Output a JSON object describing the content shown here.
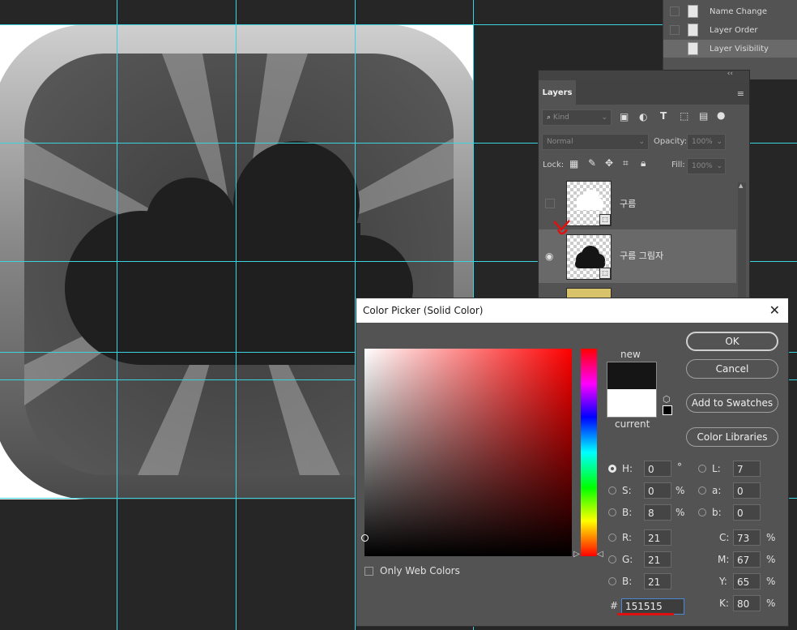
{
  "history": {
    "items": [
      "Name Change",
      "Layer Order",
      "Layer Visibility"
    ]
  },
  "layers_panel": {
    "tab": "Layers",
    "kind_placeholder": "Kind",
    "blend_mode": "Normal",
    "opacity_label": "Opacity:",
    "opacity_value": "100%",
    "lock_label": "Lock:",
    "fill_label": "Fill:",
    "fill_value": "100%",
    "layers": [
      {
        "name": "구름",
        "visible": false
      },
      {
        "name": "구름 그림자",
        "visible": true
      }
    ]
  },
  "color_picker": {
    "title": "Color Picker (Solid Color)",
    "new_label": "new",
    "current_label": "current",
    "new_color": "#151515",
    "current_color": "#ffffff",
    "buttons": {
      "ok": "OK",
      "cancel": "Cancel",
      "add_to_swatches": "Add to Swatches",
      "color_libraries": "Color Libraries"
    },
    "only_web_colors": "Only Web Colors",
    "fields": {
      "H": {
        "label": "H:",
        "value": "0",
        "unit": "°"
      },
      "S": {
        "label": "S:",
        "value": "0",
        "unit": "%"
      },
      "B": {
        "label": "B:",
        "value": "8",
        "unit": "%"
      },
      "R": {
        "label": "R:",
        "value": "21"
      },
      "G": {
        "label": "G:",
        "value": "21"
      },
      "Bl": {
        "label": "B:",
        "value": "21"
      },
      "L": {
        "label": "L:",
        "value": "7"
      },
      "a": {
        "label": "a:",
        "value": "0"
      },
      "b": {
        "label": "b:",
        "value": "0"
      },
      "C": {
        "label": "C:",
        "value": "73",
        "unit": "%"
      },
      "M": {
        "label": "M:",
        "value": "67",
        "unit": "%"
      },
      "Y": {
        "label": "Y:",
        "value": "65",
        "unit": "%"
      },
      "K": {
        "label": "K:",
        "value": "80",
        "unit": "%"
      }
    },
    "hex_label": "#",
    "hex_value": "151515"
  }
}
